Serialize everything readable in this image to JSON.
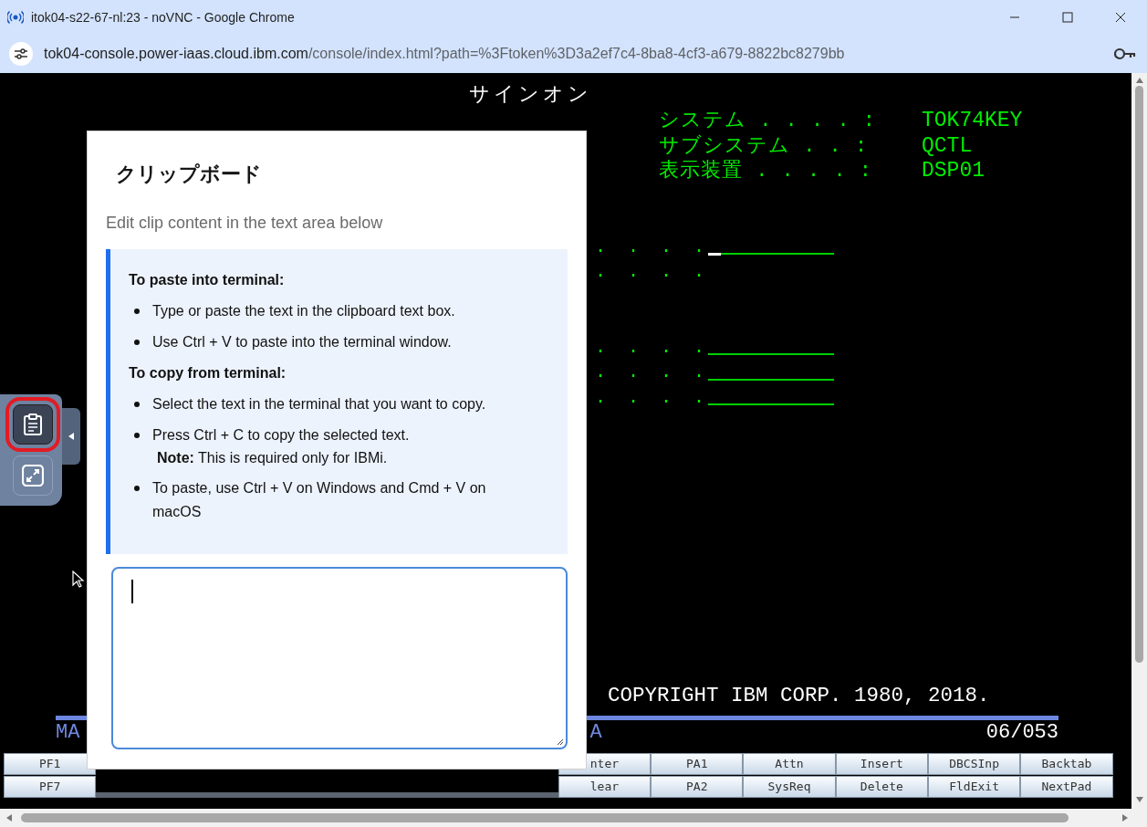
{
  "browser": {
    "title": "itok04-s22-67-nl:23 - noVNC - Google Chrome",
    "url_host": "tok04-console.power-iaas.cloud.ibm.com",
    "url_path": "/console/index.html?path=%3Ftoken%3D3a2ef7c4-8ba8-4cf3-a679-8822bc8279bb"
  },
  "terminal": {
    "screen_title": "サインオン",
    "system_info": [
      {
        "label": "システム . . . . :",
        "value": "TOK74KEY"
      },
      {
        "label": "サブシステム . . :",
        "value": "QCTL"
      },
      {
        "label": "表示装置 . . . . :",
        "value": "DSP01"
      }
    ],
    "prompt_rows": [
      {
        "dots": ". . . .",
        "kind": "field",
        "cursor": true
      },
      {
        "dots": ". . . .",
        "kind": "text",
        "cursor": false
      },
      {
        "dots": ". . . .",
        "kind": "field",
        "cursor": false
      },
      {
        "dots": ". . . .",
        "kind": "field",
        "cursor": false
      },
      {
        "dots": ". . . .",
        "kind": "field",
        "cursor": false
      }
    ],
    "copyright": "COPYRIGHT IBM CORP. 1980, 2018.",
    "status_left": "MA",
    "status_middle": "A",
    "cursor_position": "06/053"
  },
  "keypad": {
    "rows": [
      {
        "left": [
          "PF1"
        ],
        "right": [
          "nter",
          "PA1",
          "Attn",
          "Insert",
          "DBCSInp",
          "Backtab"
        ]
      },
      {
        "left": [
          "PF7"
        ],
        "right": [
          "lear",
          "PA2",
          "SysReq",
          "Delete",
          "FldExit",
          "NextPad"
        ]
      }
    ]
  },
  "side_panel": {
    "buttons": [
      {
        "kind": "clipboard",
        "selected": true
      },
      {
        "kind": "fullscreen",
        "selected": false
      }
    ]
  },
  "clipboard_dialog": {
    "title": "クリップボード",
    "subtitle": "Edit clip content in the text area below",
    "sections": [
      {
        "heading": "To paste into terminal:",
        "items": [
          {
            "text": "Type or paste the text in the clipboard text box."
          },
          {
            "text": "Use Ctrl + V to paste into the terminal window."
          }
        ]
      },
      {
        "heading": "To copy from terminal:",
        "items": [
          {
            "text": "Select the text in the terminal that you want to copy."
          },
          {
            "text": "Press Ctrl + C to copy the selected text.",
            "note": "**Note:** This is required only for IBMi."
          },
          {
            "text": "To paste, use Ctrl + V on Windows and Cmd + V on macOS"
          }
        ]
      }
    ],
    "textarea": {
      "focused": true
    }
  }
}
